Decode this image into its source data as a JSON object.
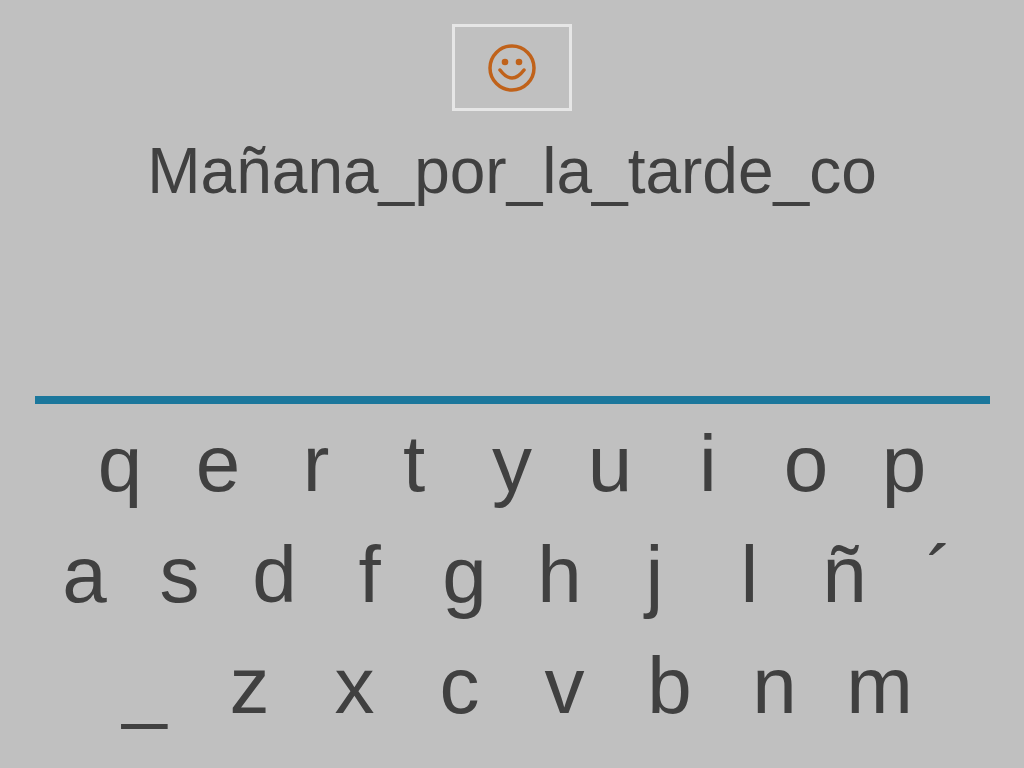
{
  "answer": "Mañana_por_la_tarde_co",
  "keyboard_rows": [
    [
      "q",
      "e",
      "r",
      "t",
      "y",
      "u",
      "i",
      "o",
      "p"
    ],
    [
      "a",
      "s",
      "d",
      "f",
      "g",
      "h",
      "j",
      "l",
      "ñ",
      "´"
    ],
    [
      "_",
      "z",
      "x",
      "c",
      "v",
      "b",
      "n",
      "m"
    ]
  ]
}
